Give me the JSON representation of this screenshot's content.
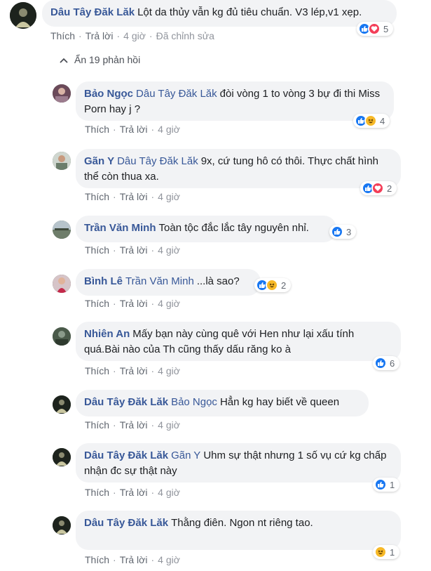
{
  "top_comment": {
    "author": "Dâu Tây Đăk Lăk",
    "text": "Lột da thủy vẫn kg đủ tiêu chuẩn. V3 lép,v1 xẹp.",
    "like": "Thích",
    "reply": "Trả lời",
    "time": "4 giờ",
    "edited": "Đã chỉnh sửa",
    "reaction_count": "5"
  },
  "hide_replies_label": "Ẩn 19 phản hồi",
  "replies": [
    {
      "author": "Bảo Ngọc",
      "mention": "Dâu Tây Đăk Lăk",
      "text": "đòi vòng 1 to vòng 3 bự đi thi Miss Porn hay j ?",
      "like": "Thích",
      "reply": "Trả lời",
      "time": "4 giờ",
      "reaction_count": "4"
    },
    {
      "author": "Gãn Y",
      "mention": "Dâu Tây Đăk Lăk",
      "text": "9x, cứ tung hô có thôi. Thực chất hình thể còn thua xa.",
      "like": "Thích",
      "reply": "Trả lời",
      "time": "4 giờ",
      "reaction_count": "2"
    },
    {
      "author": "Trần Văn Minh",
      "mention": "",
      "text": "Toàn tộc đắc lắc tây nguyên nhỉ.",
      "like": "Thích",
      "reply": "Trả lời",
      "time": "4 giờ",
      "reaction_count": "3"
    },
    {
      "author": "Bình Lê",
      "mention": "Trần Văn Minh",
      "text": "...là sao?",
      "like": "Thích",
      "reply": "Trả lời",
      "time": "4 giờ",
      "reaction_count": "2"
    },
    {
      "author": "Nhiên An",
      "mention": "",
      "text": "Mấy bạn này cùng quê với Hen như lại xấu tính quá.Bài nào của Th cũng thấy dấu răng ko à",
      "like": "Thích",
      "reply": "Trả lời",
      "time": "4 giờ",
      "reaction_count": "6"
    },
    {
      "author": "Dâu Tây Đăk Lăk",
      "mention": "Bảo Ngọc",
      "text": "Hẳn kg hay biết về queen",
      "like": "Thích",
      "reply": "Trả lời",
      "time": "4 giờ",
      "reaction_count": ""
    },
    {
      "author": "Dâu Tây Đăk Lăk",
      "mention": "Gãn Y",
      "text": "Uhm sự thật nhưng 1 số vụ cứ kg chấp nhận đc sự thật này",
      "like": "Thích",
      "reply": "Trả lời",
      "time": "4 giờ",
      "reaction_count": "1"
    },
    {
      "author": "Dâu Tây Đăk Lăk",
      "mention": "Trần Văn Minh",
      "text": "Thằng điên. Ngon nt riêng tao.",
      "like": "Thích",
      "reply": "Trả lời",
      "time": "4 giờ",
      "reaction_count": "1"
    }
  ],
  "colors": {
    "link": "#385898",
    "bubble": "#f2f3f5",
    "meta": "#90949c",
    "like": "#1877f2",
    "love": "#f33e58",
    "haha": "#f7b928"
  },
  "icons": [
    "chevron-up-icon",
    "like-reaction-icon",
    "love-reaction-icon",
    "haha-reaction-icon"
  ]
}
